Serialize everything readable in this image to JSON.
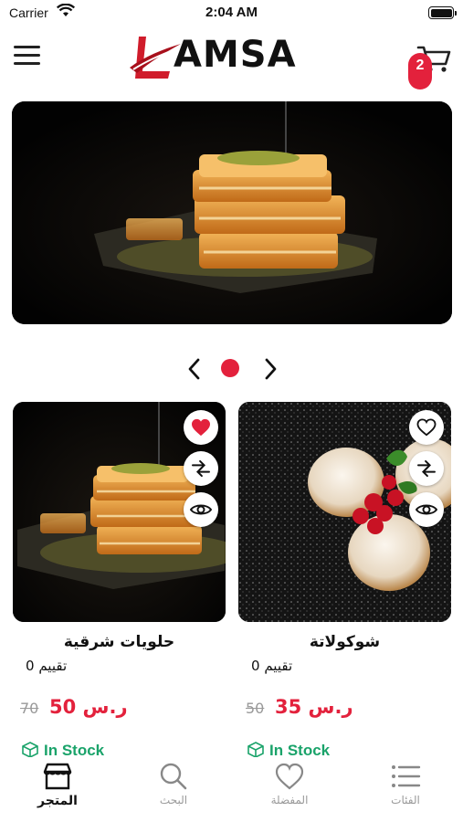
{
  "status_bar": {
    "carrier": "Carrier",
    "time": "2:04 AM"
  },
  "header": {
    "logo_text": "AMSA",
    "cart_count": "2"
  },
  "products": [
    {
      "title": "حلويات شرقية",
      "rating": "تقييم 0",
      "new_price": "ر.س 50",
      "old_price": "70",
      "stock": "In Stock",
      "favorited": true
    },
    {
      "title": "شوكولاتة",
      "rating": "تقييم 0",
      "new_price": "ر.س 35",
      "old_price": "50",
      "stock": "In Stock",
      "favorited": false
    }
  ],
  "bottom_nav": [
    {
      "label": "المتجر",
      "icon": "store-icon",
      "active": true
    },
    {
      "label": "البحث",
      "icon": "search-icon",
      "active": false
    },
    {
      "label": "المفضلة",
      "icon": "heart-icon",
      "active": false
    },
    {
      "label": "الفئات",
      "icon": "list-icon",
      "active": false
    }
  ],
  "colors": {
    "accent": "#e3213c",
    "stock": "#1aa36a"
  }
}
